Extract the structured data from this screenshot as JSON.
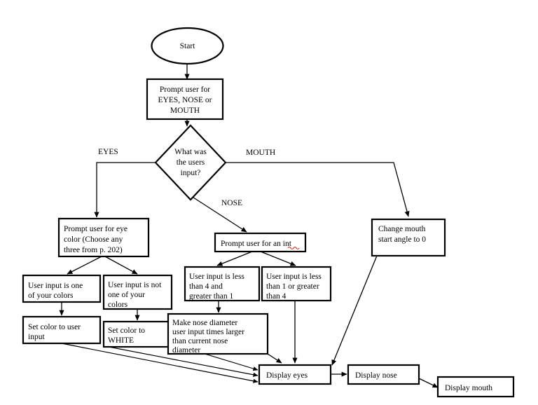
{
  "diagram": {
    "title": "Face drawing program flowchart",
    "background_color": "#ffffff",
    "line_color": "#000000",
    "spellcheck_underline_color": "#e01b1b"
  },
  "nodes": {
    "start": {
      "label": "Start",
      "shape": "ellipse"
    },
    "prompt_part": {
      "lines": [
        "Prompt user for",
        "EYES, NOSE or",
        "MOUTH"
      ],
      "shape": "rectangle"
    },
    "decision": {
      "lines": [
        "What was",
        "the users",
        "input?"
      ],
      "shape": "diamond"
    },
    "prompt_eye_color": {
      "lines": [
        "Prompt user for eye",
        "color  (Choose any",
        "three from p. 202)"
      ],
      "shape": "rectangle"
    },
    "input_is_color": {
      "lines": [
        "User input is one",
        "of your colors"
      ],
      "shape": "rectangle"
    },
    "input_not_color": {
      "lines": [
        "User input is not",
        "one of your",
        "colors"
      ],
      "shape": "rectangle"
    },
    "set_color_user": {
      "lines": [
        "Set color to user",
        "input"
      ],
      "shape": "rectangle"
    },
    "set_color_white": {
      "lines": [
        "Set color to",
        "WHITE"
      ],
      "shape": "rectangle"
    },
    "prompt_int": {
      "lines": [
        "Prompt user for an int"
      ],
      "shape": "rectangle",
      "misspelled_word": "int"
    },
    "int_in_range": {
      "lines": [
        "User input is less",
        "than 4 and",
        "greater than 1"
      ],
      "shape": "rectangle"
    },
    "int_out_range": {
      "lines": [
        "User input is less",
        "than 1 or greater",
        "than 4"
      ],
      "shape": "rectangle"
    },
    "make_nose": {
      "lines": [
        "Make nose diameter",
        "user input times larger",
        "than current nose",
        "diameter"
      ],
      "shape": "rectangle"
    },
    "change_mouth": {
      "lines": [
        "Change mouth",
        "start angle to 0"
      ],
      "shape": "rectangle"
    },
    "display_eyes": {
      "lines": [
        "Display eyes"
      ],
      "shape": "rectangle"
    },
    "display_nose": {
      "lines": [
        "Display nose"
      ],
      "shape": "rectangle"
    },
    "display_mouth": {
      "lines": [
        "Display mouth"
      ],
      "shape": "rectangle"
    }
  },
  "edge_labels": {
    "eyes": "EYES",
    "mouth": "MOUTH",
    "nose": "NOSE"
  }
}
